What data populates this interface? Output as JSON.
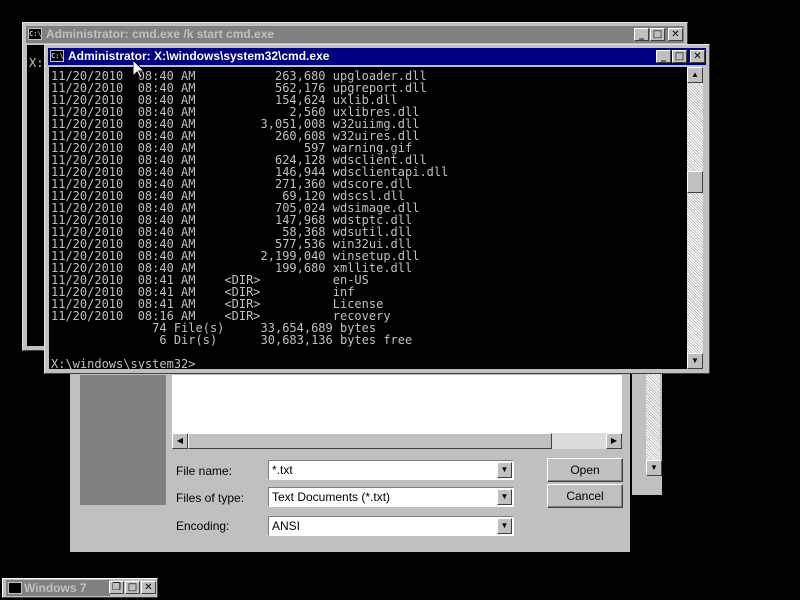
{
  "open_dialog": {
    "file_name_label": "File name:",
    "file_name_value": "*.txt",
    "file_type_label": "Files of type:",
    "file_type_value": "Text Documents (*.txt)",
    "encoding_label": "Encoding:",
    "encoding_value": "ANSI",
    "open_button": "Open",
    "cancel_button": "Cancel"
  },
  "cmd_back": {
    "title": "Administrator: cmd.exe /k start cmd.exe",
    "prompt_fragment": "X:"
  },
  "cmd_front": {
    "title": "Administrator: X:\\windows\\system32\\cmd.exe",
    "lines": [
      "11/20/2010  08:40 AM           263,680 upgloader.dll",
      "11/20/2010  08:40 AM           562,176 upgreport.dll",
      "11/20/2010  08:40 AM           154,624 uxlib.dll",
      "11/20/2010  08:40 AM             2,560 uxlibres.dll",
      "11/20/2010  08:40 AM         3,051,008 w32uiimg.dll",
      "11/20/2010  08:40 AM           260,608 w32uires.dll",
      "11/20/2010  08:40 AM               597 warning.gif",
      "11/20/2010  08:40 AM           624,128 wdsclient.dll",
      "11/20/2010  08:40 AM           146,944 wdsclientapi.dll",
      "11/20/2010  08:40 AM           271,360 wdscore.dll",
      "11/20/2010  08:40 AM            69,120 wdscsl.dll",
      "11/20/2010  08:40 AM           705,024 wdsimage.dll",
      "11/20/2010  08:40 AM           147,968 wdstptc.dll",
      "11/20/2010  08:40 AM            58,368 wdsutil.dll",
      "11/20/2010  08:40 AM           577,536 win32ui.dll",
      "11/20/2010  08:40 AM         2,199,040 winsetup.dll",
      "11/20/2010  08:40 AM           199,680 xmllite.dll",
      "11/20/2010  08:41 AM    <DIR>          en-US",
      "11/20/2010  08:41 AM    <DIR>          inf",
      "11/20/2010  08:41 AM    <DIR>          License",
      "11/20/2010  08:16 AM    <DIR>          recovery",
      "              74 File(s)     33,654,689 bytes",
      "               6 Dir(s)      30,683,136 bytes free",
      "",
      "X:\\windows\\system32>"
    ]
  },
  "taskbar": {
    "item_label": "Windows 7"
  },
  "icons": {
    "minimize": "_",
    "maximize": "□",
    "close": "✕",
    "restore": "❐"
  }
}
